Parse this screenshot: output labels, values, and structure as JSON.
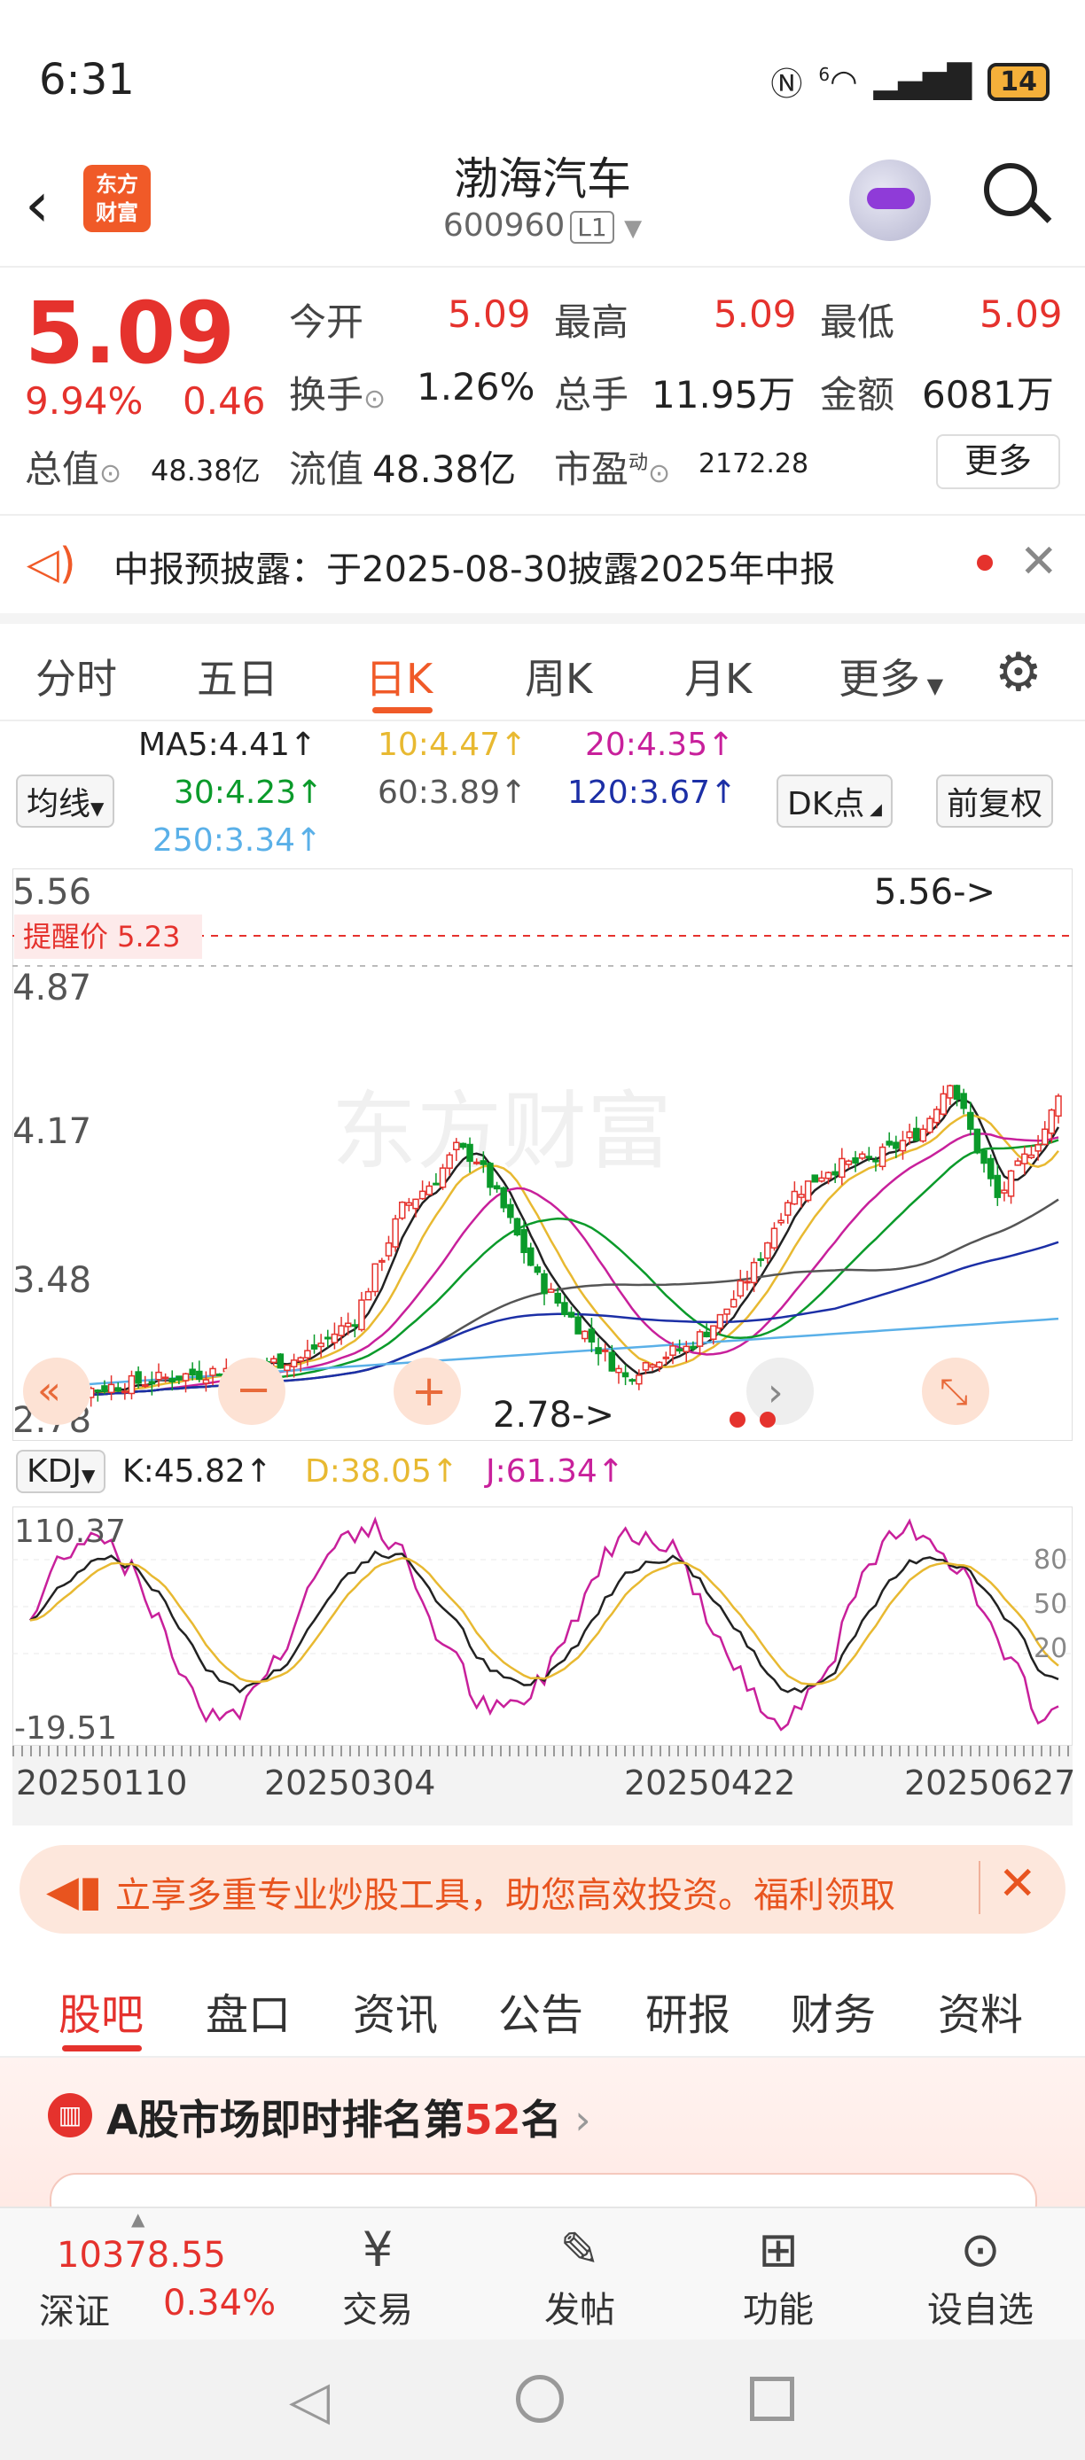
{
  "status": {
    "time": "6:31",
    "battery": "14",
    "signal": "6"
  },
  "header": {
    "title": "渤海汽车",
    "code": "600960",
    "level": "L1",
    "logo_line1": "东方",
    "logo_line2": "财富"
  },
  "quote": {
    "price": "5.09",
    "pct": "9.94%",
    "change": "0.46",
    "open_label": "今开",
    "open": "5.09",
    "high_label": "最高",
    "high": "5.09",
    "low_label": "最低",
    "low": "5.09",
    "turnover_label": "换手",
    "turnover": "1.26%",
    "volume_label": "总手",
    "volume": "11.95万",
    "amount_label": "金额",
    "amount": "6081万",
    "total_cap_label": "总值",
    "total_cap": "48.38亿",
    "float_cap_label": "流值",
    "float_cap": "48.38亿",
    "pe_label": "市盈",
    "pe_sup": "动",
    "pe": "2172.28",
    "more": "更多"
  },
  "notice": {
    "text": "中报预披露：于2025-08-30披露2025年中报"
  },
  "chart_tabs": [
    "分时",
    "五日",
    "日K",
    "周K",
    "月K",
    "更多"
  ],
  "active_chart_tab": "日K",
  "ma": {
    "selector": "均线",
    "ma5": "MA5:4.41",
    "ma10": "10:4.47",
    "ma20": "20:4.35",
    "ma30": "30:4.23",
    "ma60": "60:3.89",
    "ma120": "120:3.67",
    "ma250": "250:3.34",
    "dk": "DK点",
    "adjust": "前复权",
    "colors": {
      "ma5": "#222222",
      "ma10": "#e8b931",
      "ma20": "#c8209b",
      "ma30": "#0a9a2a",
      "ma60": "#555555",
      "ma120": "#1c2fa6",
      "ma250": "#5ab0e8"
    }
  },
  "kchart": {
    "ylabels": [
      "5.56",
      "4.87",
      "4.17",
      "3.48",
      "2.78"
    ],
    "alert_label": "提醒价 5.23",
    "high_marker": "5.56->",
    "low_marker": "2.78->",
    "watermark": "东方财富"
  },
  "kdj": {
    "selector": "KDJ",
    "k": "K:45.82",
    "d": "D:38.05",
    "j": "J:61.34",
    "top": "110.37",
    "bottom": "-19.51",
    "right_labels": [
      "80",
      "50",
      "20"
    ]
  },
  "dates": [
    "20250110",
    "20250304",
    "20250422",
    "20250627"
  ],
  "promo": {
    "text": "立享多重专业炒股工具，助您高效投资。福利领取"
  },
  "info_tabs": [
    "股吧",
    "盘口",
    "资讯",
    "公告",
    "研报",
    "财务",
    "资料"
  ],
  "rank": {
    "prefix": "A股市场即时排名第",
    "num": "52",
    "suffix": "名"
  },
  "bottom_nav": {
    "index_value": "10378.55",
    "index_name": "深证",
    "index_pct": "0.34%",
    "items": [
      "交易",
      "发帖",
      "功能",
      "设自选"
    ]
  },
  "chart_data": {
    "type": "candlestick",
    "title": "",
    "ylim": [
      2.78,
      5.56
    ],
    "x_ticks": [
      "20250110",
      "20250304",
      "20250422",
      "20250627"
    ],
    "high": 5.56,
    "low": 2.78,
    "alert_price": 5.23,
    "ma_last": {
      "MA5": 4.41,
      "MA10": 4.47,
      "MA20": 4.35,
      "MA30": 4.23,
      "MA60": 3.89,
      "MA120": 3.67,
      "MA250": 3.34
    },
    "kdj_last": {
      "K": 45.82,
      "D": 38.05,
      "J": 61.34
    },
    "kdj_ylim": [
      -19.51,
      110.37
    ]
  }
}
